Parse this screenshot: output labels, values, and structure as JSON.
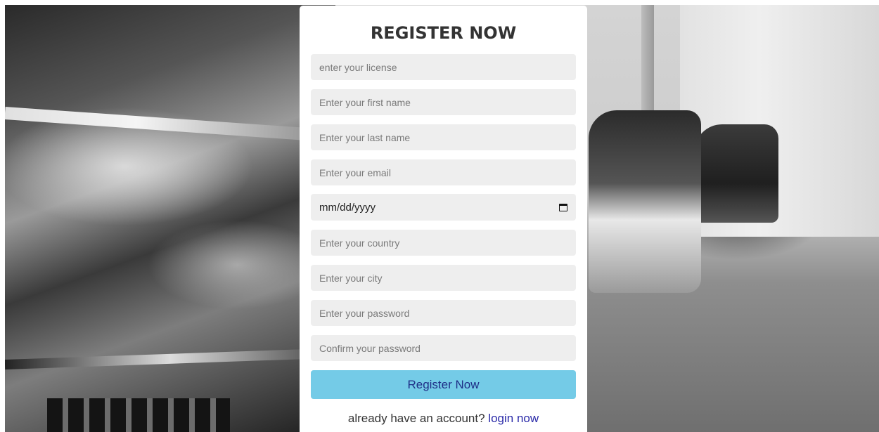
{
  "form": {
    "title": "REGISTER NOW",
    "fields": {
      "license": "enter your license",
      "first_name": "Enter your first name",
      "last_name": "Enter your last name",
      "email": "Enter your email",
      "dob": "mm/dd/yyyy",
      "country": "Enter your country",
      "city": "Enter your city",
      "password": "Enter your password",
      "confirm_password": "Confirm your password"
    },
    "submit_label": "Register Now",
    "footer_text": "already have an account?",
    "login_link": "login now"
  },
  "colors": {
    "button_bg": "#74cbe7",
    "button_text": "#1f2f87",
    "link": "#2a2aa8",
    "field_bg": "#eeeeee"
  },
  "icons": {
    "date_picker": "calendar-icon"
  }
}
